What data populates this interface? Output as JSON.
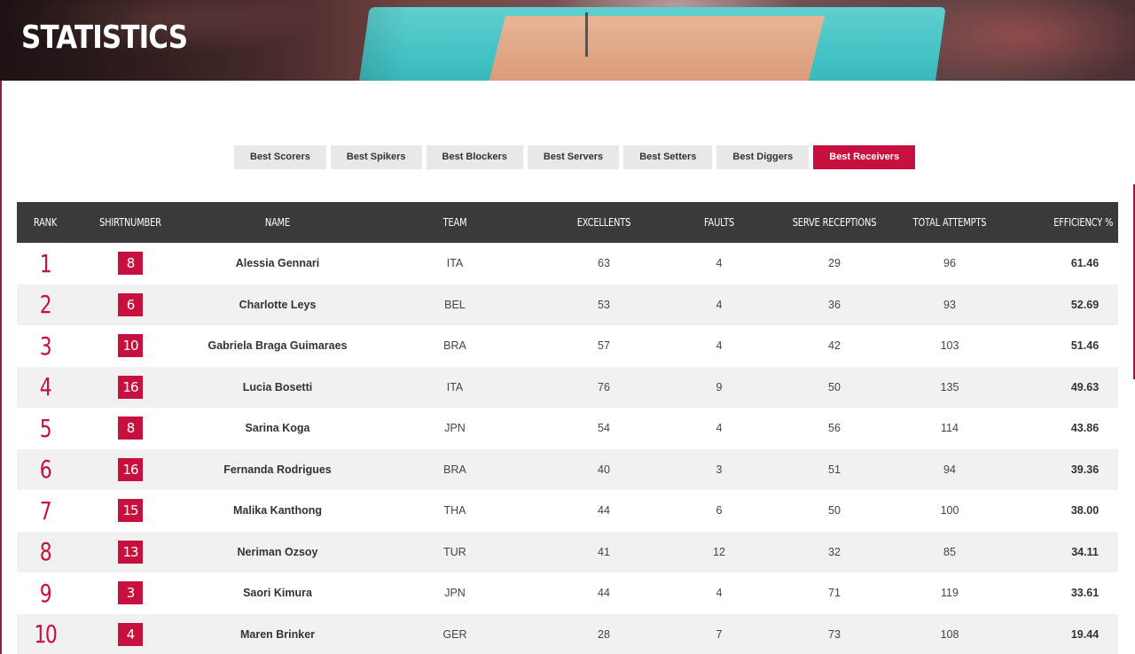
{
  "header": {
    "title": "STATISTICS"
  },
  "tabs": [
    {
      "label": "Best Scorers",
      "active": false
    },
    {
      "label": "Best Spikers",
      "active": false
    },
    {
      "label": "Best Blockers",
      "active": false
    },
    {
      "label": "Best Servers",
      "active": false
    },
    {
      "label": "Best Setters",
      "active": false
    },
    {
      "label": "Best Diggers",
      "active": false
    },
    {
      "label": "Best Receivers",
      "active": true
    }
  ],
  "table": {
    "columns": [
      "RANK",
      "SHIRTNUMBER",
      "NAME",
      "TEAM",
      "EXCELLENTS",
      "FAULTS",
      "SERVE RECEPTIONS",
      "TOTAL ATTEMPTS",
      "EFFICIENCY %"
    ],
    "rows": [
      {
        "rank": "1",
        "shirt": "8",
        "name": "Alessia Gennari",
        "team": "ITA",
        "excellents": "63",
        "faults": "4",
        "serve": "29",
        "total": "96",
        "efficiency": "61.46"
      },
      {
        "rank": "2",
        "shirt": "6",
        "name": "Charlotte Leys",
        "team": "BEL",
        "excellents": "53",
        "faults": "4",
        "serve": "36",
        "total": "93",
        "efficiency": "52.69"
      },
      {
        "rank": "3",
        "shirt": "10",
        "name": "Gabriela Braga Guimaraes",
        "team": "BRA",
        "excellents": "57",
        "faults": "4",
        "serve": "42",
        "total": "103",
        "efficiency": "51.46"
      },
      {
        "rank": "4",
        "shirt": "16",
        "name": "Lucia Bosetti",
        "team": "ITA",
        "excellents": "76",
        "faults": "9",
        "serve": "50",
        "total": "135",
        "efficiency": "49.63"
      },
      {
        "rank": "5",
        "shirt": "8",
        "name": "Sarina Koga",
        "team": "JPN",
        "excellents": "54",
        "faults": "4",
        "serve": "56",
        "total": "114",
        "efficiency": "43.86"
      },
      {
        "rank": "6",
        "shirt": "16",
        "name": "Fernanda Rodrigues",
        "team": "BRA",
        "excellents": "40",
        "faults": "3",
        "serve": "51",
        "total": "94",
        "efficiency": "39.36"
      },
      {
        "rank": "7",
        "shirt": "15",
        "name": "Malika Kanthong",
        "team": "THA",
        "excellents": "44",
        "faults": "6",
        "serve": "50",
        "total": "100",
        "efficiency": "38.00"
      },
      {
        "rank": "8",
        "shirt": "13",
        "name": "Neriman Ozsoy",
        "team": "TUR",
        "excellents": "41",
        "faults": "12",
        "serve": "32",
        "total": "85",
        "efficiency": "34.11"
      },
      {
        "rank": "9",
        "shirt": "3",
        "name": "Saori Kimura",
        "team": "JPN",
        "excellents": "44",
        "faults": "4",
        "serve": "71",
        "total": "119",
        "efficiency": "33.61"
      },
      {
        "rank": "10",
        "shirt": "4",
        "name": "Maren Brinker",
        "team": "GER",
        "excellents": "28",
        "faults": "7",
        "serve": "73",
        "total": "108",
        "efficiency": "19.44"
      }
    ]
  },
  "colors": {
    "accent": "#c8103e",
    "header_bg": "#3a3a3a",
    "row_alt": "#f1f1f1",
    "tab_bg": "#e8e8e8"
  }
}
